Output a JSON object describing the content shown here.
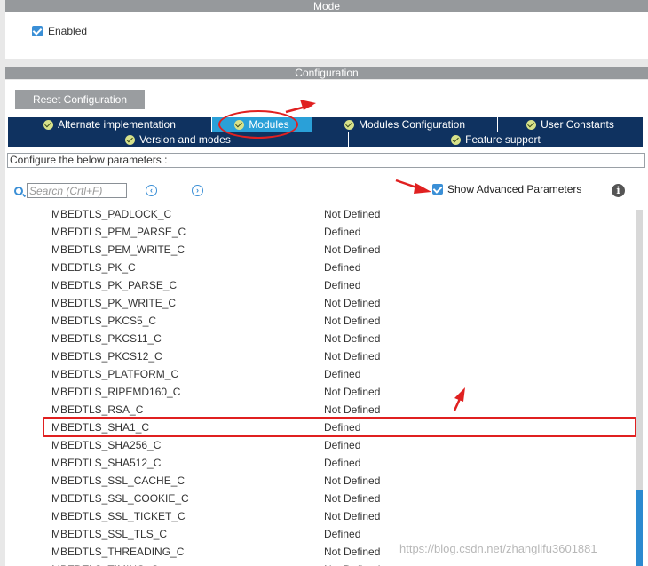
{
  "mode": {
    "header": "Mode",
    "enabled_label": "Enabled",
    "enabled_checked": true
  },
  "configuration": {
    "header": "Configuration",
    "reset_button": "Reset Configuration",
    "tabs_row1": [
      {
        "label": "Alternate implementation",
        "active": false
      },
      {
        "label": "Modules",
        "active": true
      },
      {
        "label": "Modules Configuration",
        "active": false
      },
      {
        "label": "User Constants",
        "active": false
      }
    ],
    "tabs_row2": [
      {
        "label": "Version and modes",
        "active": false
      },
      {
        "label": "Feature support",
        "active": false
      }
    ],
    "caption": "Configure the below parameters :",
    "search_placeholder": "Search (Crtl+F)",
    "show_advanced_label": "Show Advanced Parameters",
    "show_advanced_checked": true,
    "params": [
      {
        "name": "MBEDTLS_PADLOCK_C",
        "value": "Not Defined"
      },
      {
        "name": "MBEDTLS_PEM_PARSE_C",
        "value": "Defined"
      },
      {
        "name": "MBEDTLS_PEM_WRITE_C",
        "value": "Not Defined"
      },
      {
        "name": "MBEDTLS_PK_C",
        "value": "Defined"
      },
      {
        "name": "MBEDTLS_PK_PARSE_C",
        "value": "Defined"
      },
      {
        "name": "MBEDTLS_PK_WRITE_C",
        "value": "Not Defined"
      },
      {
        "name": "MBEDTLS_PKCS5_C",
        "value": "Not Defined"
      },
      {
        "name": "MBEDTLS_PKCS11_C",
        "value": "Not Defined"
      },
      {
        "name": "MBEDTLS_PKCS12_C",
        "value": "Not Defined"
      },
      {
        "name": "MBEDTLS_PLATFORM_C",
        "value": "Defined"
      },
      {
        "name": "MBEDTLS_RIPEMD160_C",
        "value": "Not Defined"
      },
      {
        "name": "MBEDTLS_RSA_C",
        "value": "Not Defined"
      },
      {
        "name": "MBEDTLS_SHA1_C",
        "value": "Defined",
        "highlighted": true
      },
      {
        "name": "MBEDTLS_SHA256_C",
        "value": "Defined"
      },
      {
        "name": "MBEDTLS_SHA512_C",
        "value": "Defined"
      },
      {
        "name": "MBEDTLS_SSL_CACHE_C",
        "value": "Not Defined"
      },
      {
        "name": "MBEDTLS_SSL_COOKIE_C",
        "value": "Not Defined"
      },
      {
        "name": "MBEDTLS_SSL_TICKET_C",
        "value": "Not Defined"
      },
      {
        "name": "MBEDTLS_SSL_TLS_C",
        "value": "Defined"
      },
      {
        "name": "MBEDTLS_THREADING_C",
        "value": "Not Defined"
      },
      {
        "name": "MBEDTLS_TIMING_C",
        "value": "Not Defined"
      }
    ]
  },
  "watermark": "https://blog.csdn.net/zhanglifu3601881",
  "colors": {
    "tab_bg": "#0f3260",
    "tab_active": "#2aa0d8",
    "annotation": "#e02020",
    "accent": "#3a8fd6"
  }
}
